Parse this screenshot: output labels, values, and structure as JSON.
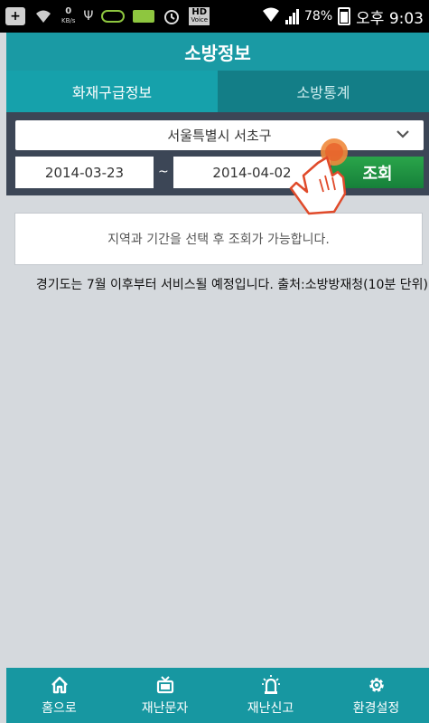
{
  "status_bar": {
    "icons": [
      "add-icon",
      "wifi-tether-icon",
      "data-speed-icon",
      "usb-icon",
      "chat-icon",
      "notification-icon",
      "alarm-icon",
      "hd-voice-icon",
      "wifi-icon",
      "signal-icon",
      "battery-charging-icon"
    ],
    "speed_value": "0",
    "speed_unit": "KB/s",
    "hd_label": "HD",
    "voice_label": "Voice",
    "battery": "78%",
    "time": "오후 9:03"
  },
  "app": {
    "title": "소방정보"
  },
  "tabs": [
    {
      "label": "화재구급정보",
      "active": true
    },
    {
      "label": "소방통계",
      "active": false
    }
  ],
  "filter": {
    "region": "서울특별시 서초구",
    "start_date": "2014-03-23",
    "separator": "~",
    "end_date": "2014-04-02",
    "search_label": "조회"
  },
  "result": {
    "message": "지역과 기간을 선택 후 조회가 가능합니다."
  },
  "notice": "경기도는 7월 이후부터 서비스될 예정입니다. 출처:소방방재청(10분 단위)",
  "bottom_nav": [
    {
      "label": "홈으로",
      "icon": "home-icon"
    },
    {
      "label": "재난문자",
      "icon": "tv-icon"
    },
    {
      "label": "재난신고",
      "icon": "siren-icon"
    },
    {
      "label": "환경설정",
      "icon": "gear-icon"
    }
  ],
  "colors": {
    "teal": "#1a9aa4",
    "tab_inactive": "#137e87",
    "filter_bg": "#3c4656",
    "search_green": "#1f9443",
    "page_bg": "#d5d9dd"
  }
}
